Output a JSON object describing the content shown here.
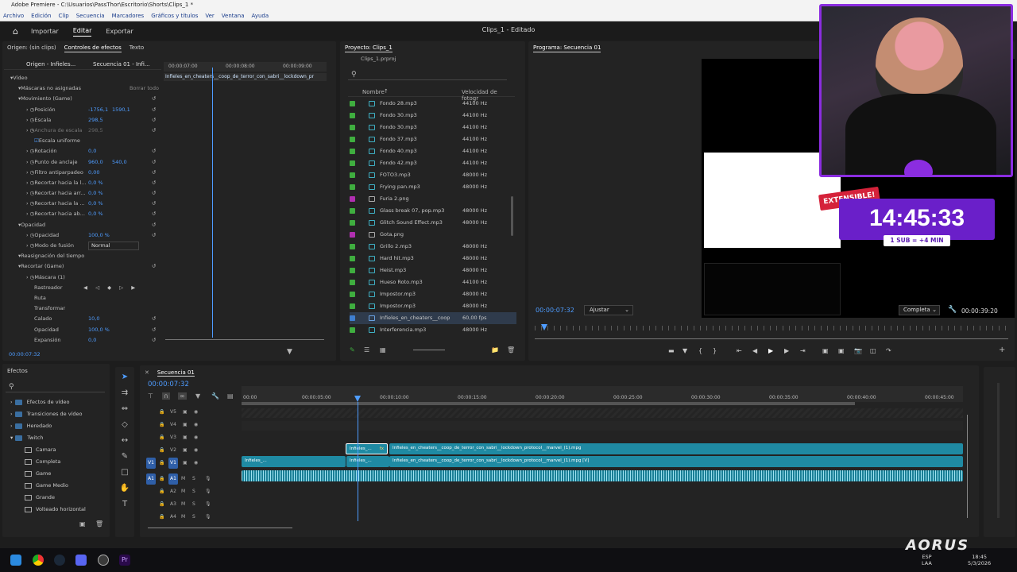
{
  "window": {
    "title": "Adobe Premiere - C:\\Usuarios\\PassThor\\Escritorio\\Shorts\\Clips_1 *",
    "menu": [
      "Archivo",
      "Edición",
      "Clip",
      "Secuencia",
      "Marcadores",
      "Gráficos y títulos",
      "Ver",
      "Ventana",
      "Ayuda"
    ]
  },
  "nav": {
    "tabs": [
      "Importar",
      "Editar",
      "Exportar"
    ],
    "doc_title": "Clips_1 - Editado"
  },
  "effect_controls": {
    "tabs": [
      "Origen: (sin clips)",
      "Controles de efectos",
      "Texto"
    ],
    "source_label": "Origen - Infieles...",
    "sequence_label": "Secuencia 01 - Infi...",
    "ruler": [
      "00:00:07:00",
      "00:00:08:00",
      "00:00:09:00"
    ],
    "clip_label": "Infieles_en_cheaters__coop_de_terror_con_sabri__lockdown_pr",
    "rows": [
      {
        "indent": 0,
        "label": "Vídeo",
        "value": "",
        "value2": ""
      },
      {
        "indent": 1,
        "label": "Máscaras no asignadas",
        "value": "",
        "value2": "",
        "extra": "Borrar todo"
      },
      {
        "indent": 1,
        "label": "Movimiento (Game)",
        "value": "",
        "value2": ""
      },
      {
        "indent": 2,
        "label": "Posición",
        "value": "-1756,1",
        "value2": "1590,1"
      },
      {
        "indent": 2,
        "label": "Escala",
        "value": "298,5",
        "value2": ""
      },
      {
        "indent": 2,
        "label": "Anchura de escala",
        "value": "298,5",
        "value2": "",
        "dim": true
      },
      {
        "indent": 3,
        "label": "Escala uniforme",
        "value": "",
        "value2": "",
        "check": true
      },
      {
        "indent": 2,
        "label": "Rotación",
        "value": "0,0",
        "value2": ""
      },
      {
        "indent": 2,
        "label": "Punto de anclaje",
        "value": "960,0",
        "value2": "540,0"
      },
      {
        "indent": 2,
        "label": "Filtro antiparpadeo",
        "value": "0,00",
        "value2": ""
      },
      {
        "indent": 2,
        "label": "Recortar hacia la l...",
        "value": "0,0 %",
        "value2": ""
      },
      {
        "indent": 2,
        "label": "Recortar hacia arr...",
        "value": "0,0 %",
        "value2": ""
      },
      {
        "indent": 2,
        "label": "Recortar hacia la ...",
        "value": "0,0 %",
        "value2": ""
      },
      {
        "indent": 2,
        "label": "Recortar hacia ab...",
        "value": "0,0 %",
        "value2": ""
      },
      {
        "indent": 1,
        "label": "Opacidad",
        "value": "",
        "value2": ""
      },
      {
        "indent": 2,
        "label": "Opacidad",
        "value": "100,0 %",
        "value2": ""
      },
      {
        "indent": 2,
        "label": "Modo de fusión",
        "value": "Normal",
        "value2": "",
        "select": true
      },
      {
        "indent": 1,
        "label": "Reasignación del tiempo",
        "value": "",
        "value2": ""
      },
      {
        "indent": 1,
        "label": "Recortar (Game)",
        "value": "",
        "value2": ""
      },
      {
        "indent": 2,
        "label": "Máscara (1)",
        "value": "",
        "value2": ""
      },
      {
        "indent": 3,
        "label": "Rastreador",
        "value": "",
        "value2": "",
        "tracker": true
      },
      {
        "indent": 3,
        "label": "Ruta",
        "value": "",
        "value2": ""
      },
      {
        "indent": 3,
        "label": "Transformar",
        "value": "",
        "value2": ""
      },
      {
        "indent": 3,
        "label": "Calado",
        "value": "10,0",
        "value2": ""
      },
      {
        "indent": 3,
        "label": "Opacidad",
        "value": "100,0 %",
        "value2": ""
      },
      {
        "indent": 3,
        "label": "Expansión",
        "value": "0,0",
        "value2": ""
      }
    ],
    "timecode": "00:00:07:32"
  },
  "project": {
    "title": "Proyecto: Clips_1",
    "file": "Clips_1.prproj",
    "col_name": "Nombre",
    "col_rate": "Velocidad de fotogr",
    "items": [
      {
        "name": "Fondo 28.mp3",
        "rate": "44100 Hz",
        "color": "#3fae3f",
        "kind": "audio"
      },
      {
        "name": "Fondo 30.mp3",
        "rate": "44100 Hz",
        "color": "#3fae3f",
        "kind": "audio"
      },
      {
        "name": "Fondo 30.mp3",
        "rate": "44100 Hz",
        "color": "#3fae3f",
        "kind": "audio"
      },
      {
        "name": "Fondo 37.mp3",
        "rate": "44100 Hz",
        "color": "#3fae3f",
        "kind": "audio"
      },
      {
        "name": "Fondo 40.mp3",
        "rate": "44100 Hz",
        "color": "#3fae3f",
        "kind": "audio"
      },
      {
        "name": "Fondo 42.mp3",
        "rate": "44100 Hz",
        "color": "#3fae3f",
        "kind": "audio"
      },
      {
        "name": "FOTO3.mp3",
        "rate": "48000 Hz",
        "color": "#3fae3f",
        "kind": "audio"
      },
      {
        "name": "Frying pan.mp3",
        "rate": "48000 Hz",
        "color": "#3fae3f",
        "kind": "audio"
      },
      {
        "name": "Furia 2.png",
        "rate": "",
        "color": "#b02fb0",
        "kind": "image"
      },
      {
        "name": "Glass break 07, pop.mp3",
        "rate": "48000 Hz",
        "color": "#3fae3f",
        "kind": "audio"
      },
      {
        "name": "Glitch Sound Effect.mp3",
        "rate": "48000 Hz",
        "color": "#3fae3f",
        "kind": "audio"
      },
      {
        "name": "Gota.png",
        "rate": "",
        "color": "#b02fb0",
        "kind": "image"
      },
      {
        "name": "Grillo 2.mp3",
        "rate": "48000 Hz",
        "color": "#3fae3f",
        "kind": "audio"
      },
      {
        "name": "Hard hit.mp3",
        "rate": "48000 Hz",
        "color": "#3fae3f",
        "kind": "audio"
      },
      {
        "name": "Heist.mp3",
        "rate": "48000 Hz",
        "color": "#3fae3f",
        "kind": "audio"
      },
      {
        "name": "Hueso Roto.mp3",
        "rate": "44100 Hz",
        "color": "#3fae3f",
        "kind": "audio"
      },
      {
        "name": "Impostor.mp3",
        "rate": "48000 Hz",
        "color": "#3fae3f",
        "kind": "audio"
      },
      {
        "name": "Impostor.mp3",
        "rate": "48000 Hz",
        "color": "#3fae3f",
        "kind": "audio"
      },
      {
        "name": "Infieles_en_cheaters__coop",
        "rate": "60,00 fps",
        "color": "#3f7fd0",
        "kind": "video",
        "selected": true
      },
      {
        "name": "Interferencia.mp3",
        "rate": "48000 Hz",
        "color": "#3fae3f",
        "kind": "audio"
      }
    ]
  },
  "program": {
    "title": "Programa: Secuencia 01",
    "timecode": "00:00:07:32",
    "fit": "Ajustar",
    "quality": "Completa",
    "duration": "00:00:39:20"
  },
  "overlay": {
    "badge": "EXTENSIBLE!",
    "timer": "14:45:33",
    "rule": "1 SUB = +4 MIN"
  },
  "effects_panel": {
    "title": "Efectos",
    "items": [
      {
        "label": "Efectos de vídeo",
        "indent": 0,
        "type": "folder"
      },
      {
        "label": "Transiciones de vídeo",
        "indent": 0,
        "type": "folder"
      },
      {
        "label": "Heredado",
        "indent": 0,
        "type": "folder"
      },
      {
        "label": "Twitch",
        "indent": 0,
        "type": "folder",
        "open": true
      },
      {
        "label": "Camara",
        "indent": 1,
        "type": "preset"
      },
      {
        "label": "Completa",
        "indent": 1,
        "type": "preset"
      },
      {
        "label": "Game",
        "indent": 1,
        "type": "preset"
      },
      {
        "label": "Game Medio",
        "indent": 1,
        "type": "preset"
      },
      {
        "label": "Grande",
        "indent": 1,
        "type": "preset"
      },
      {
        "label": "Volteado horizontal",
        "indent": 1,
        "type": "preset"
      }
    ]
  },
  "timeline": {
    "title": "Secuencia 01",
    "timecode": "00:00:07:32",
    "ruler": [
      "00:00",
      "00:00:05:00",
      "00:00:10:00",
      "00:00:15:00",
      "00:00:20:00",
      "00:00:25:00",
      "00:00:30:00",
      "00:00:35:00",
      "00:00:40:00",
      "00:00:45:00"
    ],
    "video_tracks": [
      "V5",
      "V4",
      "V3",
      "V2",
      "V1"
    ],
    "audio_tracks": [
      "A1",
      "A2",
      "A3",
      "A4"
    ],
    "clip_v2_small": "Infieles_...",
    "clip_v2_main": "Infieles_en_cheaters__coop_de_terror_con_sabri__lockdown_protocol__marvel_(1).mpg",
    "clip_v1_a": "Infieles_...",
    "clip_v1_b": "Infieles_...",
    "clip_v1_main": "Infieles_en_cheaters__coop_de_terror_con_sabri__lockdown_protocol__marvel_(1).mpg [V]",
    "fx": "fx"
  },
  "taskbar": {
    "lang": "ESP",
    "region": "LAA",
    "time": "18:45",
    "date": "5/3/2026",
    "brand": "AORUS"
  },
  "colors": {
    "accent": "#4e9cff",
    "timer_purple": "#6a1fc9",
    "badge_red": "#d5223a"
  }
}
